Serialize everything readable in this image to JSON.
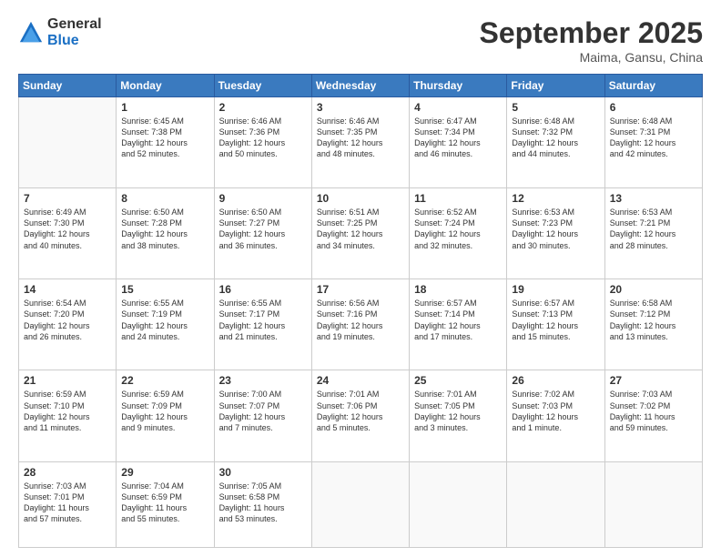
{
  "header": {
    "logo_general": "General",
    "logo_blue": "Blue",
    "month_title": "September 2025",
    "location": "Maima, Gansu, China"
  },
  "days_of_week": [
    "Sunday",
    "Monday",
    "Tuesday",
    "Wednesday",
    "Thursday",
    "Friday",
    "Saturday"
  ],
  "weeks": [
    [
      {
        "day": "",
        "info": ""
      },
      {
        "day": "1",
        "info": "Sunrise: 6:45 AM\nSunset: 7:38 PM\nDaylight: 12 hours\nand 52 minutes."
      },
      {
        "day": "2",
        "info": "Sunrise: 6:46 AM\nSunset: 7:36 PM\nDaylight: 12 hours\nand 50 minutes."
      },
      {
        "day": "3",
        "info": "Sunrise: 6:46 AM\nSunset: 7:35 PM\nDaylight: 12 hours\nand 48 minutes."
      },
      {
        "day": "4",
        "info": "Sunrise: 6:47 AM\nSunset: 7:34 PM\nDaylight: 12 hours\nand 46 minutes."
      },
      {
        "day": "5",
        "info": "Sunrise: 6:48 AM\nSunset: 7:32 PM\nDaylight: 12 hours\nand 44 minutes."
      },
      {
        "day": "6",
        "info": "Sunrise: 6:48 AM\nSunset: 7:31 PM\nDaylight: 12 hours\nand 42 minutes."
      }
    ],
    [
      {
        "day": "7",
        "info": "Sunrise: 6:49 AM\nSunset: 7:30 PM\nDaylight: 12 hours\nand 40 minutes."
      },
      {
        "day": "8",
        "info": "Sunrise: 6:50 AM\nSunset: 7:28 PM\nDaylight: 12 hours\nand 38 minutes."
      },
      {
        "day": "9",
        "info": "Sunrise: 6:50 AM\nSunset: 7:27 PM\nDaylight: 12 hours\nand 36 minutes."
      },
      {
        "day": "10",
        "info": "Sunrise: 6:51 AM\nSunset: 7:25 PM\nDaylight: 12 hours\nand 34 minutes."
      },
      {
        "day": "11",
        "info": "Sunrise: 6:52 AM\nSunset: 7:24 PM\nDaylight: 12 hours\nand 32 minutes."
      },
      {
        "day": "12",
        "info": "Sunrise: 6:53 AM\nSunset: 7:23 PM\nDaylight: 12 hours\nand 30 minutes."
      },
      {
        "day": "13",
        "info": "Sunrise: 6:53 AM\nSunset: 7:21 PM\nDaylight: 12 hours\nand 28 minutes."
      }
    ],
    [
      {
        "day": "14",
        "info": "Sunrise: 6:54 AM\nSunset: 7:20 PM\nDaylight: 12 hours\nand 26 minutes."
      },
      {
        "day": "15",
        "info": "Sunrise: 6:55 AM\nSunset: 7:19 PM\nDaylight: 12 hours\nand 24 minutes."
      },
      {
        "day": "16",
        "info": "Sunrise: 6:55 AM\nSunset: 7:17 PM\nDaylight: 12 hours\nand 21 minutes."
      },
      {
        "day": "17",
        "info": "Sunrise: 6:56 AM\nSunset: 7:16 PM\nDaylight: 12 hours\nand 19 minutes."
      },
      {
        "day": "18",
        "info": "Sunrise: 6:57 AM\nSunset: 7:14 PM\nDaylight: 12 hours\nand 17 minutes."
      },
      {
        "day": "19",
        "info": "Sunrise: 6:57 AM\nSunset: 7:13 PM\nDaylight: 12 hours\nand 15 minutes."
      },
      {
        "day": "20",
        "info": "Sunrise: 6:58 AM\nSunset: 7:12 PM\nDaylight: 12 hours\nand 13 minutes."
      }
    ],
    [
      {
        "day": "21",
        "info": "Sunrise: 6:59 AM\nSunset: 7:10 PM\nDaylight: 12 hours\nand 11 minutes."
      },
      {
        "day": "22",
        "info": "Sunrise: 6:59 AM\nSunset: 7:09 PM\nDaylight: 12 hours\nand 9 minutes."
      },
      {
        "day": "23",
        "info": "Sunrise: 7:00 AM\nSunset: 7:07 PM\nDaylight: 12 hours\nand 7 minutes."
      },
      {
        "day": "24",
        "info": "Sunrise: 7:01 AM\nSunset: 7:06 PM\nDaylight: 12 hours\nand 5 minutes."
      },
      {
        "day": "25",
        "info": "Sunrise: 7:01 AM\nSunset: 7:05 PM\nDaylight: 12 hours\nand 3 minutes."
      },
      {
        "day": "26",
        "info": "Sunrise: 7:02 AM\nSunset: 7:03 PM\nDaylight: 12 hours\nand 1 minute."
      },
      {
        "day": "27",
        "info": "Sunrise: 7:03 AM\nSunset: 7:02 PM\nDaylight: 11 hours\nand 59 minutes."
      }
    ],
    [
      {
        "day": "28",
        "info": "Sunrise: 7:03 AM\nSunset: 7:01 PM\nDaylight: 11 hours\nand 57 minutes."
      },
      {
        "day": "29",
        "info": "Sunrise: 7:04 AM\nSunset: 6:59 PM\nDaylight: 11 hours\nand 55 minutes."
      },
      {
        "day": "30",
        "info": "Sunrise: 7:05 AM\nSunset: 6:58 PM\nDaylight: 11 hours\nand 53 minutes."
      },
      {
        "day": "",
        "info": ""
      },
      {
        "day": "",
        "info": ""
      },
      {
        "day": "",
        "info": ""
      },
      {
        "day": "",
        "info": ""
      }
    ]
  ]
}
